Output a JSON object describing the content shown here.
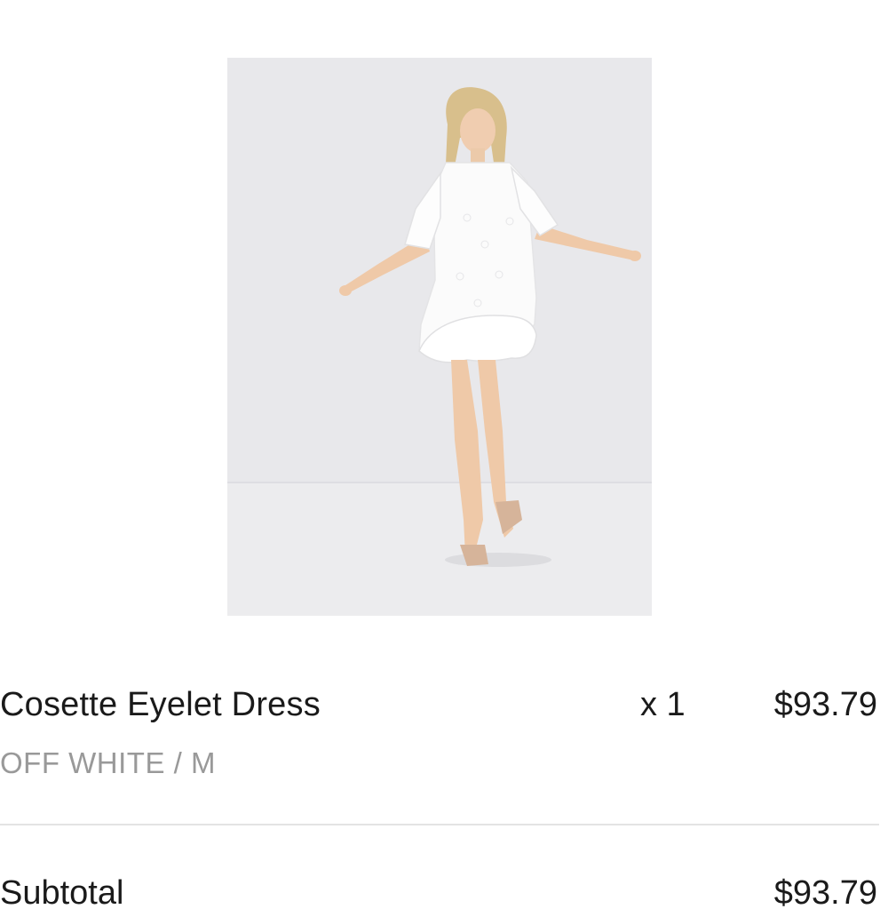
{
  "product": {
    "image_icon": "product-photo",
    "name": "Cosette Eyelet Dress",
    "variant": "OFF WHITE / M",
    "quantity": "x 1",
    "price": "$93.79"
  },
  "summary": {
    "subtotal_label": "Subtotal",
    "subtotal_value": "$93.79"
  }
}
